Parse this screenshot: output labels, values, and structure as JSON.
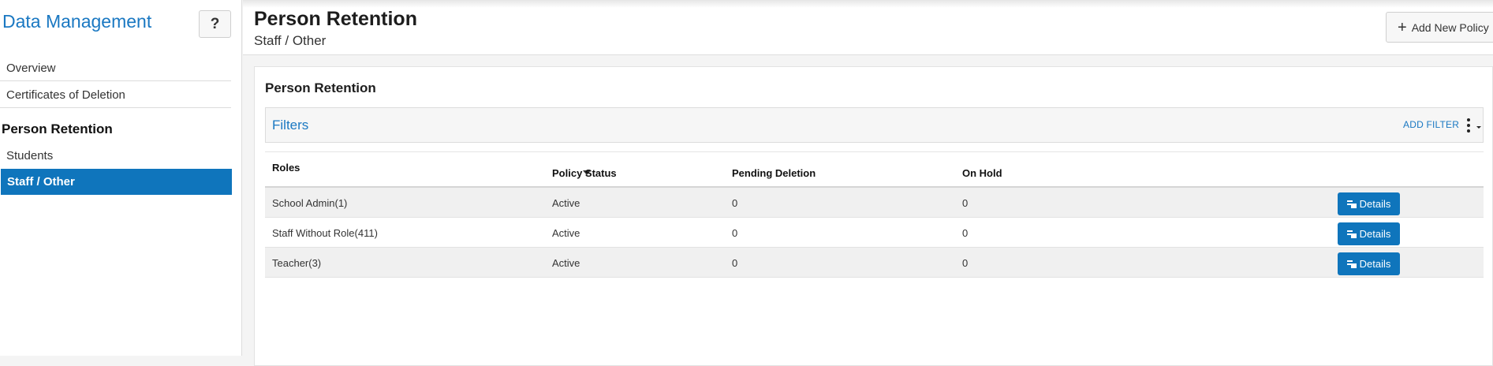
{
  "sidebar": {
    "title": "Data Management",
    "help_label": "?",
    "links": [
      {
        "label": "Overview"
      },
      {
        "label": "Certificates of Deletion"
      }
    ],
    "section_title": "Person Retention",
    "section_links": [
      {
        "label": "Students"
      },
      {
        "label": "Staff / Other"
      }
    ]
  },
  "header": {
    "title": "Person Retention",
    "subtitle": "Staff / Other",
    "add_button_label": "Add New Policy"
  },
  "panel": {
    "title": "Person Retention",
    "filters_label": "Filters",
    "add_filter_label": "ADD FILTER"
  },
  "table": {
    "columns": [
      "Roles",
      "Policy Status",
      "Pending Deletion",
      "On Hold"
    ],
    "rows": [
      {
        "role": "School Admin(1)",
        "status": "Active",
        "pending": "0",
        "hold": "0",
        "action": "Details"
      },
      {
        "role": "Staff Without Role(411)",
        "status": "Active",
        "pending": "0",
        "hold": "0",
        "action": "Details"
      },
      {
        "role": "Teacher(3)",
        "status": "Active",
        "pending": "0",
        "hold": "0",
        "action": "Details"
      }
    ]
  },
  "colors": {
    "accent": "#0f75bc",
    "link": "#1a78c2"
  }
}
